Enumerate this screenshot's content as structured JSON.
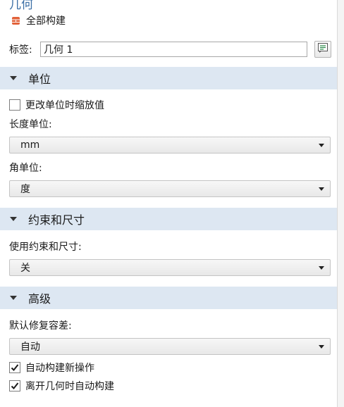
{
  "panel": {
    "title": "几何"
  },
  "build_all": {
    "label": "全部构建",
    "icon": "build-all-icon"
  },
  "label_field": {
    "label": "标签:",
    "value": "几何 1",
    "edit_icon": "edit-label-icon"
  },
  "sections": {
    "units": {
      "title": "单位"
    },
    "constraints": {
      "title": "约束和尺寸"
    },
    "advanced": {
      "title": "高级"
    }
  },
  "units": {
    "rescale_checkbox": {
      "label": "更改单位时缩放值",
      "checked": false
    },
    "length_unit": {
      "label": "长度单位:",
      "value": "mm"
    },
    "angle_unit": {
      "label": "角单位:",
      "value": "度"
    }
  },
  "constraints": {
    "use_constraints": {
      "label": "使用约束和尺寸:",
      "value": "关"
    }
  },
  "advanced": {
    "repair_tolerance": {
      "label": "默认修复容差:",
      "value": "自动"
    },
    "auto_build_new_ops": {
      "label": "自动构建新操作",
      "checked": true
    },
    "auto_build_on_leave": {
      "label": "离开几何时自动构建",
      "checked": true
    }
  },
  "colors": {
    "section_bg": "#dde7f2",
    "title_blue": "#3a6ea5",
    "build_icon": "#e2623a"
  }
}
